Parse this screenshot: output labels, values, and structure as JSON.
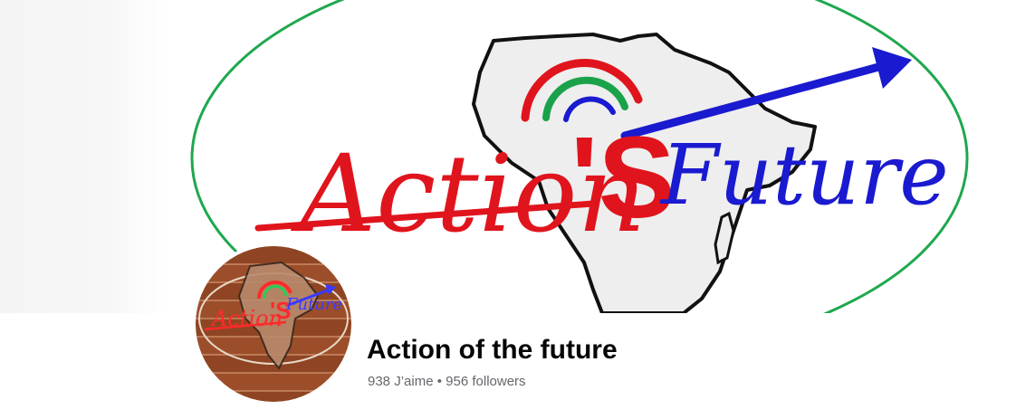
{
  "page": {
    "name": "Action of the future",
    "likes": "938 J’aime",
    "separator": "•",
    "followers": "956 followers"
  },
  "logo": {
    "word_action": "Action",
    "apostrophe_s": "'S",
    "word_future": "Future"
  },
  "colors": {
    "red": "#e0141c",
    "blue": "#1a1ad0",
    "green": "#1aa24a",
    "ellipse": "#1ea84e",
    "africa_fill": "#eeeeee",
    "brick": "#a0522d"
  },
  "icons": {
    "cover": "africa-logo-cover",
    "avatar": "brick-wall-logo-avatar"
  }
}
